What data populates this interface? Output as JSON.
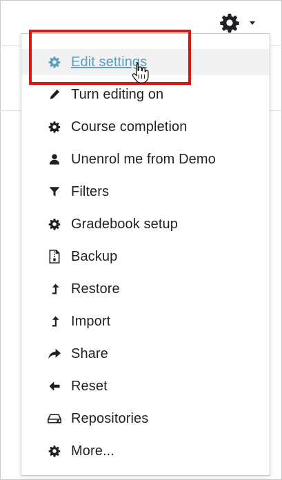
{
  "toolbar": {
    "settings_icon": "gear-icon",
    "dropdown_icon": "caret-down-icon"
  },
  "menu": {
    "items": [
      {
        "label": "Edit settings",
        "icon": "gear-icon",
        "active": true
      },
      {
        "label": "Turn editing on",
        "icon": "pencil-icon"
      },
      {
        "label": "Course completion",
        "icon": "gear-icon"
      },
      {
        "label": "Unenrol me from Demo",
        "icon": "user-icon"
      },
      {
        "label": "Filters",
        "icon": "filter-icon"
      },
      {
        "label": "Gradebook setup",
        "icon": "gear-icon"
      },
      {
        "label": "Backup",
        "icon": "file-archive-icon"
      },
      {
        "label": "Restore",
        "icon": "level-up-icon"
      },
      {
        "label": "Import",
        "icon": "level-up-icon"
      },
      {
        "label": "Share",
        "icon": "share-icon"
      },
      {
        "label": "Reset",
        "icon": "arrow-left-icon"
      },
      {
        "label": "Repositories",
        "icon": "hdd-icon"
      },
      {
        "label": "More...",
        "icon": "gear-icon"
      }
    ]
  },
  "colors": {
    "active_link": "#5a9fc6",
    "highlight_box": "#e01313",
    "text": "#1d2125",
    "icon": "#1d2125"
  }
}
